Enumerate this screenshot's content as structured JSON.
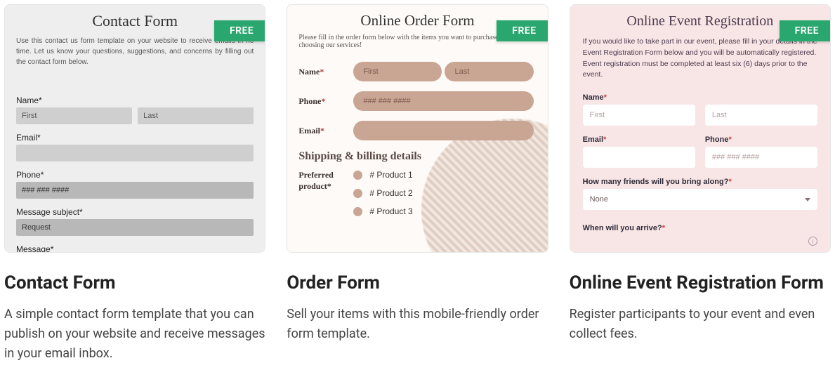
{
  "badge": "FREE",
  "cards": [
    {
      "title": "Contact Form",
      "desc": "A simple contact form template that you can publish on your website and receive messages in your email inbox.",
      "preview": {
        "heading": "Contact Form",
        "intro": "Use this contact us form template on your website to receive emails in no time. Let us know your questions, suggestions, and concerns by filling out the contact form below.",
        "name_label": "Name*",
        "first_ph": "First",
        "last_ph": "Last",
        "email_label": "Email*",
        "phone_label": "Phone*",
        "phone_ph": "### ### ####",
        "subject_label": "Message subject*",
        "subject_value": "Request",
        "message_label": "Message*"
      }
    },
    {
      "title": "Order Form",
      "desc": "Sell your items with this mobile-friendly order form template.",
      "preview": {
        "heading": "Online Order Form",
        "intro": "Please fill in the order form below with the items you want to purchase from our choosing our services!",
        "name_label": "Name",
        "first_ph": "First",
        "last_ph": "Last",
        "phone_label": "Phone",
        "phone_ph": "### ### ####",
        "email_label": "Email",
        "section": "Shipping & billing details",
        "pref_label": "Preferred product",
        "p1": "# Product 1",
        "p2": "# Product 2",
        "p3": "# Product 3"
      }
    },
    {
      "title": "Online Event Registration Form",
      "desc": "Register participants to your event and even collect fees.",
      "preview": {
        "heading": "Online Event Registration",
        "intro": "If you would like to take part in our event, please fill in your details in the Event Registration Form below and you will be automatically registered. Event registration must be completed at least six (6) days prior to the event.",
        "name_label": "Name",
        "first_ph": "First",
        "last_ph": "Last",
        "email_label": "Email",
        "phone_label": "Phone",
        "phone_ph": "### ### ####",
        "friends_label": "How many friends will you bring along?",
        "friends_value": "None",
        "arrive_label": "When will you arrive?"
      }
    }
  ]
}
